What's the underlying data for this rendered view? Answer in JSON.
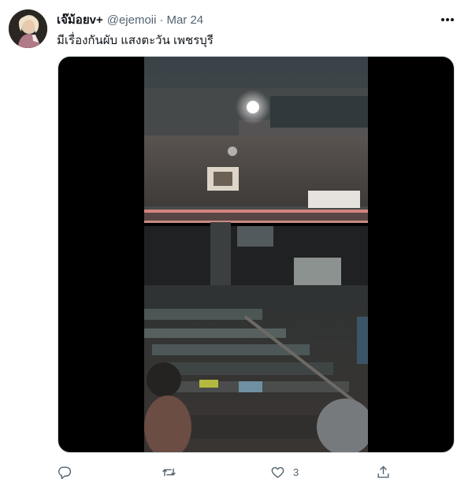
{
  "tweet": {
    "author": {
      "display_name": "เจ๊ม้อยv+",
      "handle": "@ejemoii",
      "avatar_icon": "profile-avatar"
    },
    "separator": "·",
    "date": "Mar 24",
    "text": "มีเรื่องกันผับ แสงตะวัน เพชรบุรี",
    "media": {
      "type": "video",
      "icon": "video-thumbnail"
    },
    "actions": {
      "reply_icon": "reply-icon",
      "retweet_icon": "retweet-icon",
      "like_icon": "heart-icon",
      "like_count": "3",
      "share_icon": "share-icon"
    },
    "colors": {
      "text_primary": "#0f1419",
      "text_secondary": "#536471",
      "media_background": "#000000"
    }
  }
}
